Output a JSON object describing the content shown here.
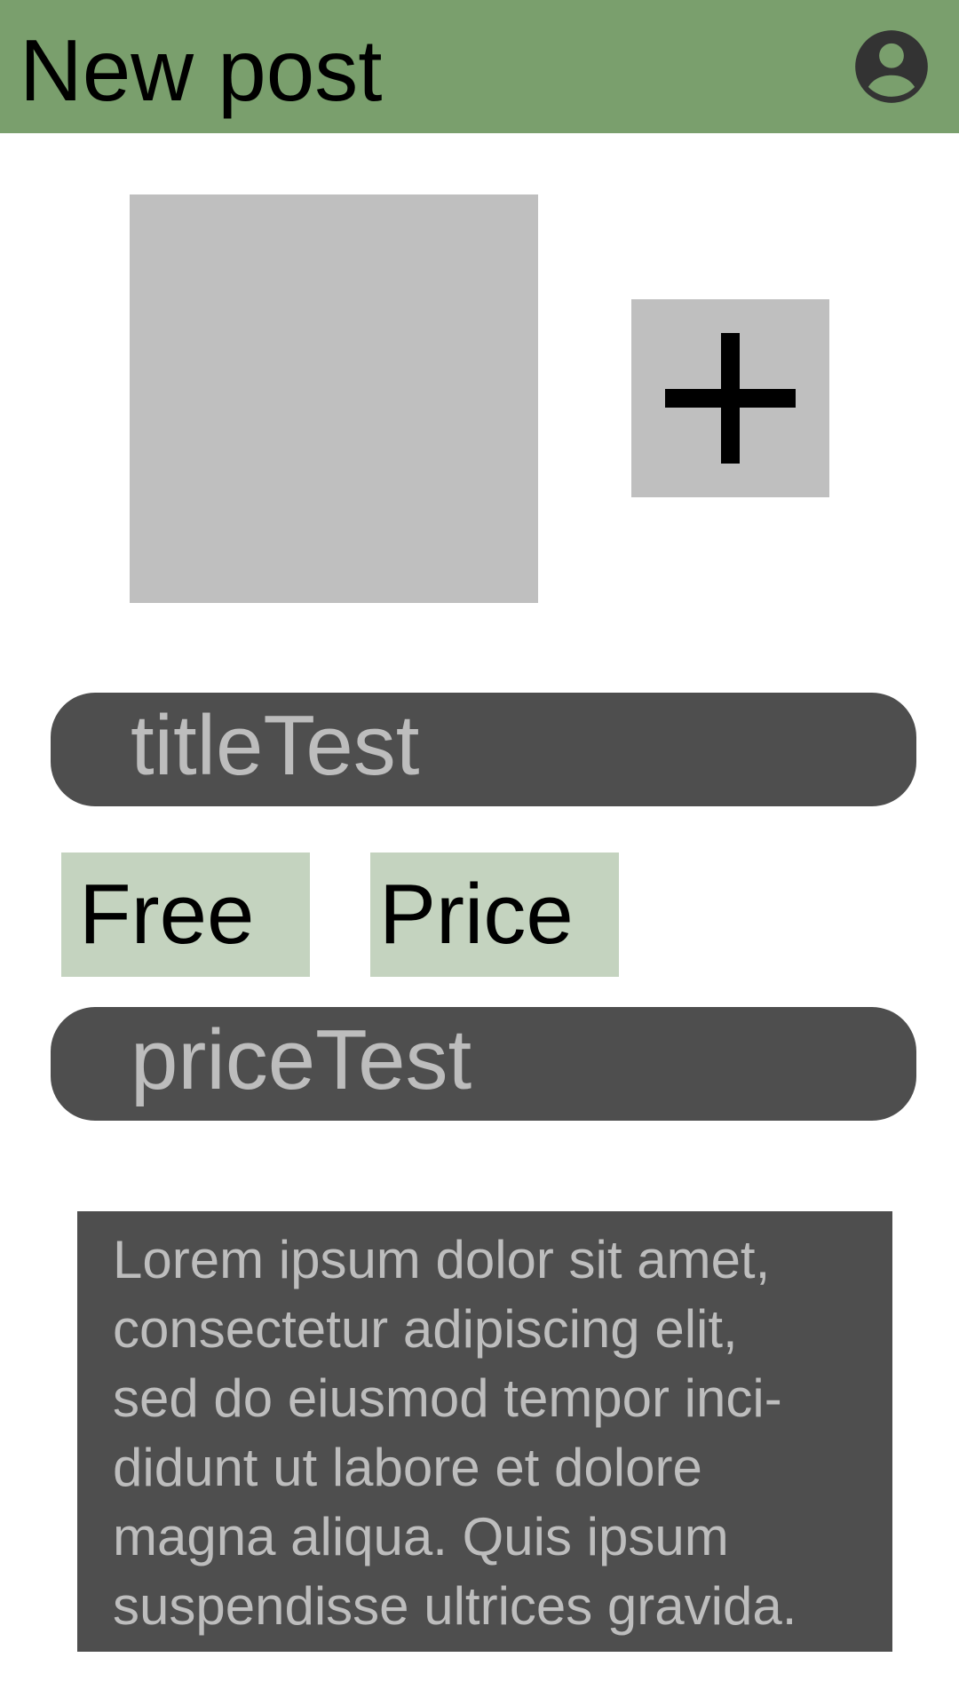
{
  "header": {
    "title": "New post",
    "avatar_icon": "account-circle-icon",
    "background_color": "#7a9f6d"
  },
  "media": {
    "add_icon": "plus-icon"
  },
  "form": {
    "title_value": "titleTest",
    "free_label": "Free",
    "price_label": "Price",
    "price_value": "priceTest",
    "description_lines": [
      "Lorem ipsum dolor sit amet,",
      "consectetur adipiscing elit,",
      "sed do eiusmod tempor inci-",
      "didunt ut labore et dolore",
      "magna aliqua. Quis ipsum",
      "suspendisse ultrices gravida."
    ]
  },
  "colors": {
    "field_background": "#4e4e4e",
    "field_text": "#bdbdbd",
    "toggle_background": "#c4d3bf",
    "placeholder_gray": "#bfbfbf"
  }
}
